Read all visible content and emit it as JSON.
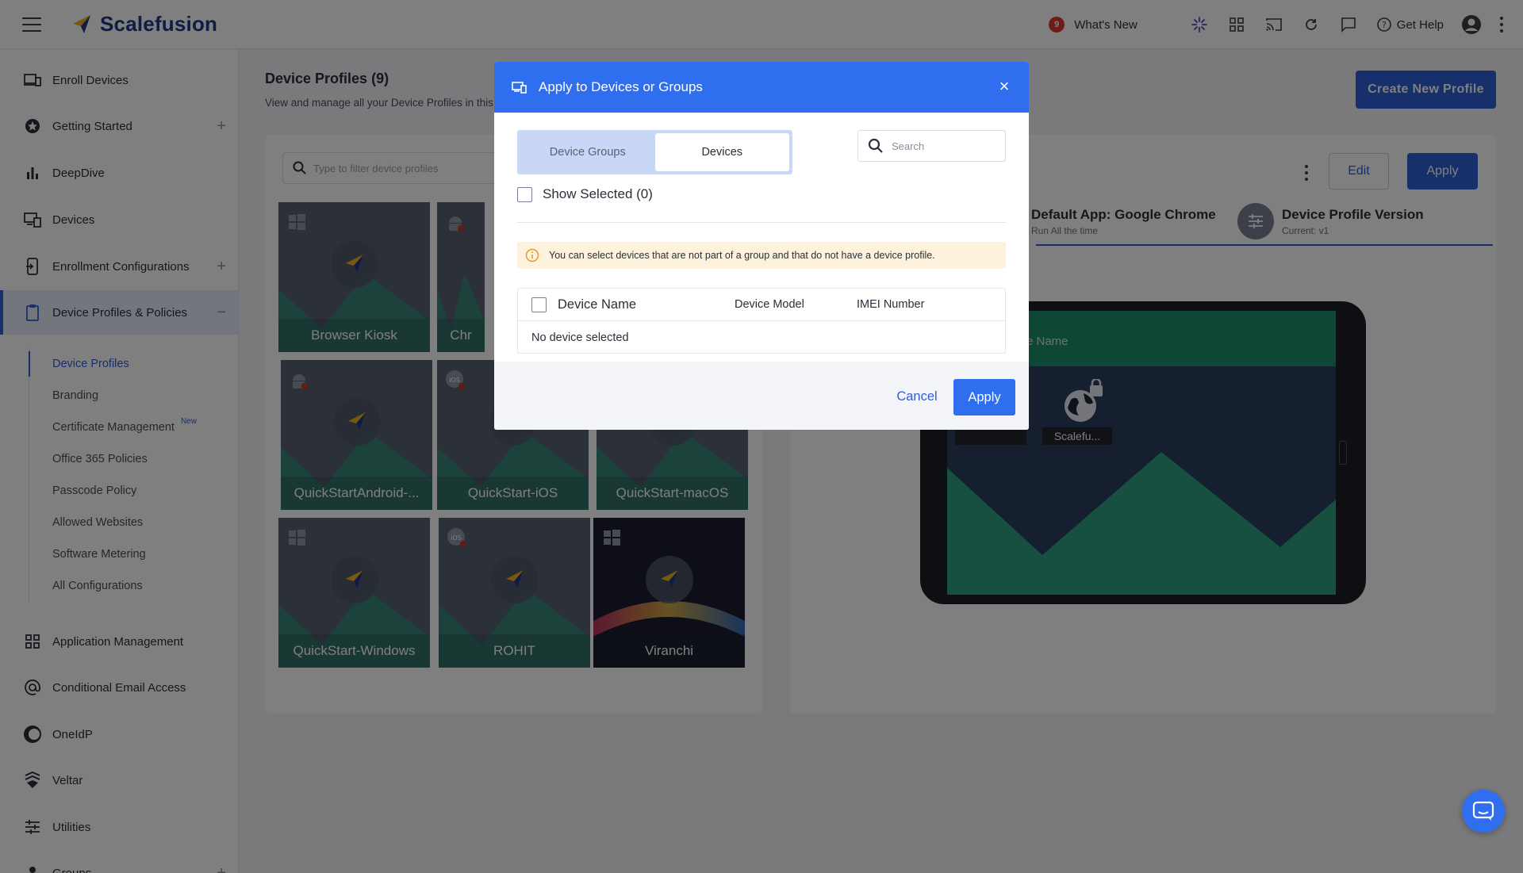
{
  "app": {
    "brand": "Scalefusion",
    "whats_new_count": "9",
    "whats_new_label": "What's New",
    "get_help_label": "Get Help"
  },
  "sidebar": {
    "items": [
      {
        "label": "Enroll Devices",
        "icon": "enroll-devices-icon"
      },
      {
        "label": "Getting Started",
        "icon": "star-icon",
        "expandable": true
      },
      {
        "label": "DeepDive",
        "icon": "bar-chart-icon"
      },
      {
        "label": "Devices",
        "icon": "devices-icon"
      },
      {
        "label": "Enrollment Configurations",
        "icon": "enrollment-config-icon",
        "expandable": true
      },
      {
        "label": "Device Profiles & Policies",
        "icon": "clipboard-icon",
        "expanded": true,
        "active": true
      },
      {
        "label": "Application Management",
        "icon": "grid-icon"
      },
      {
        "label": "Conditional Email Access",
        "icon": "at-icon"
      },
      {
        "label": "OneIdP",
        "icon": "oneidp-icon"
      },
      {
        "label": "Veltar",
        "icon": "veltar-icon"
      },
      {
        "label": "Utilities",
        "icon": "sliders-icon"
      },
      {
        "label": "Groups",
        "icon": "groups-icon",
        "expandable": true
      }
    ],
    "sub_items": [
      {
        "label": "Device Profiles",
        "active": true
      },
      {
        "label": "Branding"
      },
      {
        "label": "Certificate Management",
        "tag": "New"
      },
      {
        "label": "Office 365 Policies"
      },
      {
        "label": "Passcode Policy"
      },
      {
        "label": "Allowed Websites"
      },
      {
        "label": "Software Metering"
      },
      {
        "label": "All Configurations"
      }
    ]
  },
  "main": {
    "title": "Device Profiles (9)",
    "subtitle": "View and manage all your Device Profiles in this",
    "create_button": "Create New Profile",
    "filter_placeholder": "Type to filter device profiles",
    "profiles": [
      {
        "label": "Browser Kiosk",
        "os": "windows"
      },
      {
        "label": "Chr",
        "os": "android"
      },
      {
        "label": "QuickStartAndroid-...",
        "os": "android"
      },
      {
        "label": "QuickStart-iOS",
        "os": "ios"
      },
      {
        "label": "QuickStart-macOS",
        "os": "macos"
      },
      {
        "label": "QuickStart-Windows",
        "os": "windows"
      },
      {
        "label": "ROHIT",
        "os": "ios"
      },
      {
        "label": "Viranchi",
        "os": "windows"
      }
    ],
    "detail": {
      "edit_label": "Edit",
      "apply_label": "Apply",
      "default_app_title": "Default App: Google Chrome",
      "default_app_sub": "Run All the time",
      "version_title": "Device Profile Version",
      "version_sub": "Current: v1",
      "preview_header": "e Name",
      "preview_app_label": "Scalefu..."
    }
  },
  "modal": {
    "title": "Apply to Devices or Groups",
    "close_label": "×",
    "tabs": [
      {
        "label": "Device Groups",
        "active": false
      },
      {
        "label": "Devices",
        "active": true
      }
    ],
    "search_placeholder": "Search",
    "show_selected_label": "Show Selected (0)",
    "info_message": "You can select devices that are not part of a group and that do not have a device profile.",
    "table": {
      "columns": [
        "Device Name",
        "Device Model",
        "IMEI Number"
      ],
      "empty_text": "No device selected"
    },
    "cancel_label": "Cancel",
    "apply_label": "Apply"
  },
  "colors": {
    "primary": "#2f6fef",
    "brand_navy": "#1f3a8a",
    "badge_red": "#d93a2b",
    "warning_bg": "#fdf2dc",
    "warning_icon": "#e89a2c"
  }
}
